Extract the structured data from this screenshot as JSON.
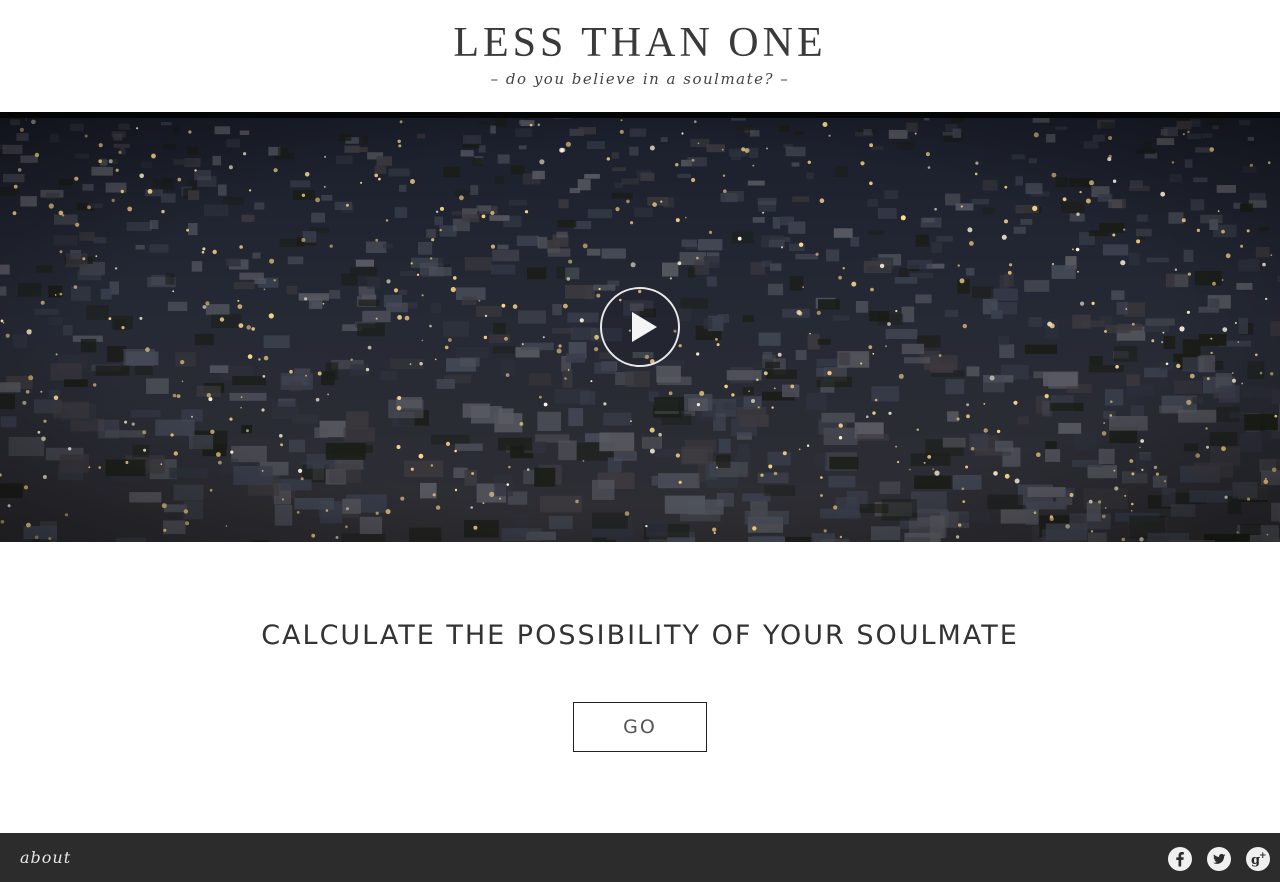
{
  "header": {
    "title": "LESS THAN ONE",
    "tagline": "– do you believe in a soulmate? –"
  },
  "video": {
    "description_icon": "play-icon"
  },
  "cta": {
    "heading": "CALCULATE THE POSSIBILITY OF YOUR SOULMATE",
    "button_label": "GO"
  },
  "footer": {
    "about_label": "about",
    "social_icons": [
      "facebook-icon",
      "twitter-icon",
      "google-plus-icon"
    ]
  },
  "colors": {
    "header_bg": "#ffffff",
    "footer_bg": "#2c2c2c",
    "text_dark": "#333333",
    "light_dots": "#ffd98a"
  }
}
